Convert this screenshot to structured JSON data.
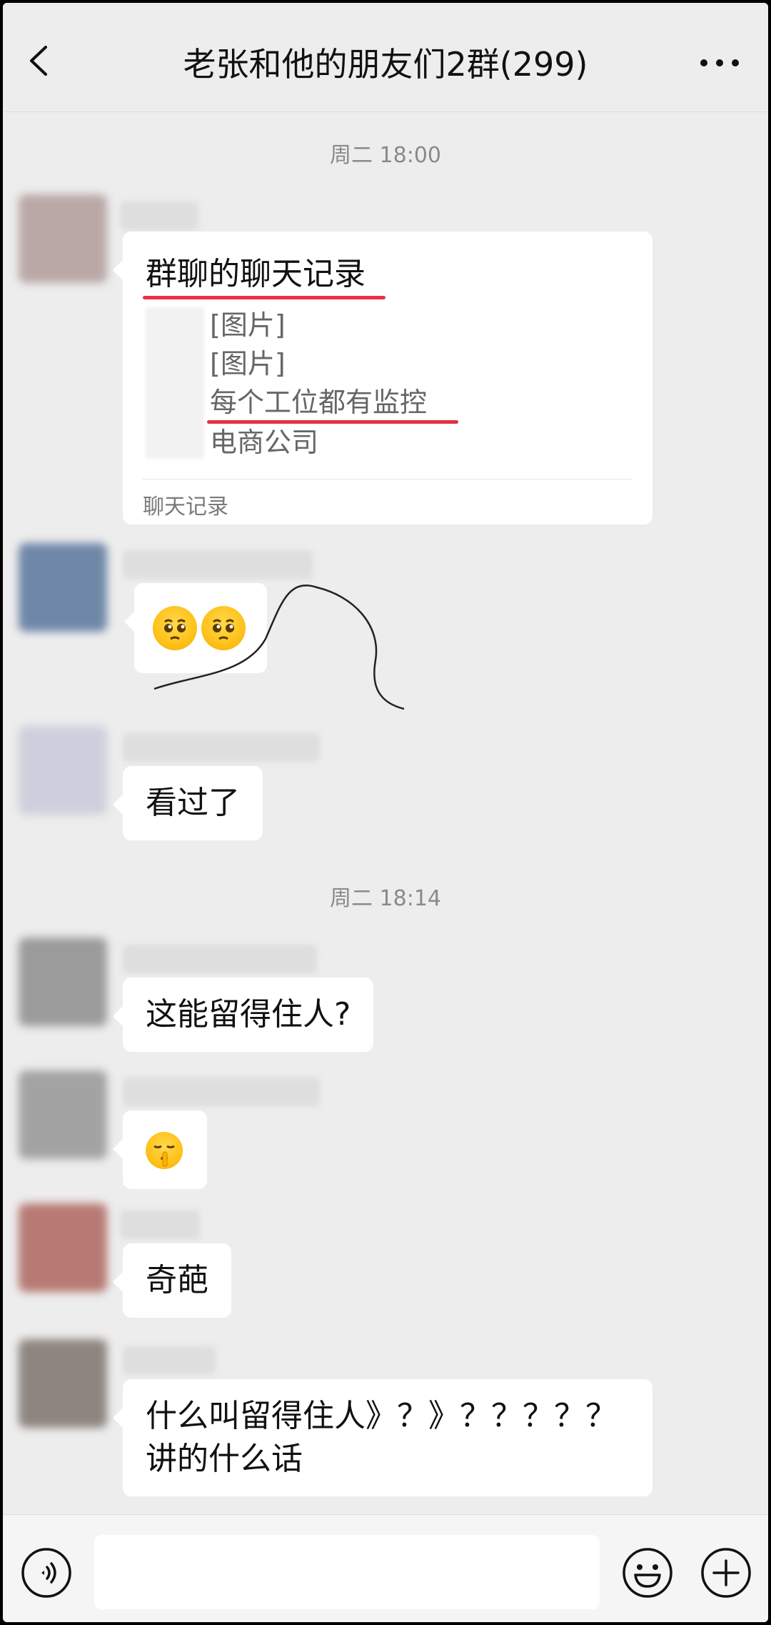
{
  "header": {
    "title": "老张和他的朋友们2群(299)",
    "back_icon": "chevron-left-icon",
    "more_icon": "more-dots-icon"
  },
  "timestamps": [
    "周二 18:00",
    "周二 18:14"
  ],
  "chat_record_card": {
    "title": "群聊的聊天记录",
    "lines": [
      "[图片]",
      "[图片]",
      "每个工位都有监控",
      "电商公司"
    ],
    "footer": "聊天记录"
  },
  "messages": [
    {
      "type": "emoji",
      "emoji": "pleading-face-icon",
      "count": 2
    },
    {
      "type": "text",
      "text": "看过了"
    },
    {
      "type": "text",
      "text": "这能留得住人?"
    },
    {
      "type": "emoji",
      "emoji": "shushing-face-icon",
      "count": 1
    },
    {
      "type": "text",
      "text": "奇葩"
    },
    {
      "type": "text",
      "text": "什么叫留得住人》？》？？？？？\n讲的什么话"
    }
  ],
  "input_bar": {
    "voice_icon": "voice-icon",
    "emoji_icon": "smiley-icon",
    "plus_icon": "plus-circle-icon",
    "placeholder": ""
  },
  "colors": {
    "background": "#ededed",
    "bubble": "#ffffff",
    "annotation_red": "#e53140"
  }
}
